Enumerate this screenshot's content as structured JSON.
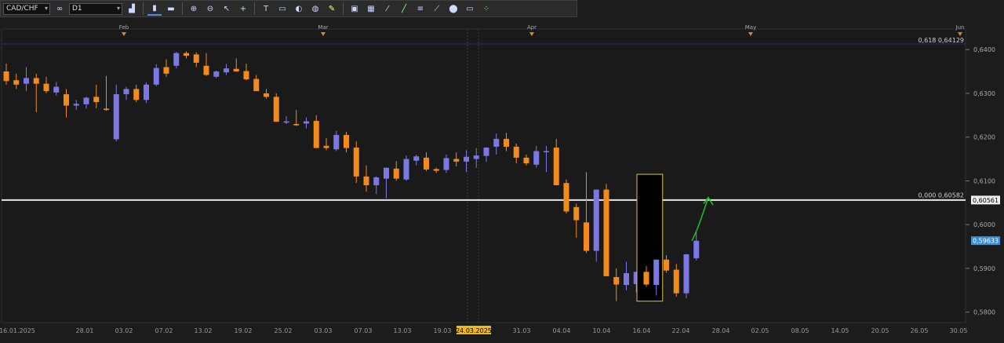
{
  "toolbar": {
    "symbol": "CAD/CHF",
    "timeframe": "D1",
    "icons": [
      "link-icon",
      "chart-type-icon",
      "candles-icon",
      "bars-icon",
      "zoom-in-icon",
      "zoom-out-icon",
      "cursor-icon",
      "crosshair-icon",
      "text-tool-icon",
      "note-icon",
      "eraser-icon",
      "globe-icon",
      "pencil-icon",
      "screenshot-icon",
      "grid-icon",
      "fibonacci-icon",
      "trendline-icon",
      "channel-icon",
      "gann-icon",
      "shapes-icon",
      "hide-icon",
      "indicators-icon"
    ]
  },
  "months": [
    "Feb",
    "Mar",
    "Apr",
    "May",
    "Jun"
  ],
  "date_labels": [
    "16.01.2025",
    "28.01",
    "03.02",
    "07.02",
    "13.02",
    "19.02",
    "25.02",
    "03.03",
    "07.03",
    "13.03",
    "19.03",
    "24.03.2025",
    "31.03",
    "04.04",
    "10.04",
    "16.04",
    "22.04",
    "28.04",
    "02.05",
    "08.05",
    "14.05",
    "20.05",
    "26.05",
    "30.05"
  ],
  "price_labels": [
    "0,6400",
    "0,6300",
    "0,6200",
    "0,6100",
    "0,6000",
    "0,5900",
    "0,5800"
  ],
  "levels": {
    "fib_618": "0,618 0,64129",
    "fib_000": "0,000 0,60582",
    "horizontal_line_price": "0,60561",
    "current_price": "0,59633"
  },
  "colors": {
    "bull": "#7b78e6",
    "bear": "#f28a1c",
    "highlight_box": "#d9c73a",
    "arrow": "#22c022",
    "current_price_bg": "#3a8fd9"
  },
  "chart_data": {
    "type": "candlestick",
    "symbol": "CAD/CHF",
    "timeframe": "D1",
    "ylim": [
      0.5776,
      0.6447
    ],
    "fib_levels": [
      {
        "label": "0,618",
        "price": 0.64129
      },
      {
        "label": "0,000",
        "price": 0.60582
      }
    ],
    "horizontal_line": 0.60561,
    "last_price": 0.59633,
    "candles": [
      [
        0.635,
        0.6368,
        0.632,
        0.6328
      ],
      [
        0.633,
        0.6345,
        0.631,
        0.632
      ],
      [
        0.6322,
        0.636,
        0.6305,
        0.6335
      ],
      [
        0.6335,
        0.6345,
        0.6257,
        0.6322
      ],
      [
        0.6322,
        0.6338,
        0.63,
        0.6305
      ],
      [
        0.6302,
        0.6326,
        0.6295,
        0.6315
      ],
      [
        0.6298,
        0.631,
        0.6245,
        0.6272
      ],
      [
        0.6272,
        0.6285,
        0.6262,
        0.6276
      ],
      [
        0.6275,
        0.6292,
        0.6265,
        0.629
      ],
      [
        0.6292,
        0.632,
        0.6266,
        0.628
      ],
      [
        0.6265,
        0.634,
        0.626,
        0.6262
      ],
      [
        0.6195,
        0.632,
        0.619,
        0.6298
      ],
      [
        0.6298,
        0.6315,
        0.6285,
        0.631
      ],
      [
        0.631,
        0.632,
        0.628,
        0.6285
      ],
      [
        0.6285,
        0.6325,
        0.6278,
        0.632
      ],
      [
        0.632,
        0.6367,
        0.6316,
        0.6358
      ],
      [
        0.636,
        0.6378,
        0.6338,
        0.6345
      ],
      [
        0.6363,
        0.6395,
        0.6357,
        0.6392
      ],
      [
        0.6392,
        0.6396,
        0.638,
        0.6386
      ],
      [
        0.6389,
        0.6394,
        0.636,
        0.637
      ],
      [
        0.6363,
        0.6392,
        0.634,
        0.6342
      ],
      [
        0.6338,
        0.6352,
        0.6335,
        0.635
      ],
      [
        0.6348,
        0.6367,
        0.6342,
        0.6357
      ],
      [
        0.6356,
        0.638,
        0.635,
        0.635
      ],
      [
        0.6351,
        0.6368,
        0.633,
        0.6332
      ],
      [
        0.6333,
        0.6342,
        0.6305,
        0.6305
      ],
      [
        0.63,
        0.631,
        0.6288,
        0.6292
      ],
      [
        0.6292,
        0.63,
        0.6235,
        0.6235
      ],
      [
        0.6233,
        0.6248,
        0.623,
        0.6236
      ],
      [
        0.623,
        0.6262,
        0.6225,
        0.6227
      ],
      [
        0.6231,
        0.6245,
        0.622,
        0.6236
      ],
      [
        0.6237,
        0.625,
        0.6175,
        0.6175
      ],
      [
        0.618,
        0.6198,
        0.617,
        0.6175
      ],
      [
        0.6172,
        0.6214,
        0.6168,
        0.6205
      ],
      [
        0.6205,
        0.6212,
        0.6165,
        0.6175
      ],
      [
        0.6176,
        0.619,
        0.6095,
        0.611
      ],
      [
        0.611,
        0.6135,
        0.6075,
        0.609
      ],
      [
        0.609,
        0.611,
        0.607,
        0.6108
      ],
      [
        0.6105,
        0.613,
        0.606,
        0.613
      ],
      [
        0.6128,
        0.6145,
        0.61,
        0.6105
      ],
      [
        0.6103,
        0.6158,
        0.61,
        0.615
      ],
      [
        0.6146,
        0.616,
        0.6135,
        0.6156
      ],
      [
        0.6153,
        0.6165,
        0.6122,
        0.6126
      ],
      [
        0.6127,
        0.613,
        0.6118,
        0.6123
      ],
      [
        0.6125,
        0.616,
        0.6118,
        0.6152
      ],
      [
        0.615,
        0.6165,
        0.6133,
        0.6144
      ],
      [
        0.6144,
        0.617,
        0.612,
        0.6155
      ],
      [
        0.615,
        0.6175,
        0.613,
        0.6158
      ],
      [
        0.6157,
        0.6177,
        0.6143,
        0.6176
      ],
      [
        0.6178,
        0.6208,
        0.616,
        0.6196
      ],
      [
        0.6196,
        0.621,
        0.6168,
        0.6178
      ],
      [
        0.6178,
        0.6185,
        0.614,
        0.6153
      ],
      [
        0.6153,
        0.616,
        0.6135,
        0.614
      ],
      [
        0.6137,
        0.618,
        0.613,
        0.6168
      ],
      [
        0.6168,
        0.618,
        0.612,
        0.6168
      ],
      [
        0.6176,
        0.6196,
        0.609,
        0.609
      ],
      [
        0.6095,
        0.6103,
        0.6025,
        0.603
      ],
      [
        0.604,
        0.6048,
        0.597,
        0.601
      ],
      [
        0.6005,
        0.612,
        0.5935,
        0.594
      ],
      [
        0.594,
        0.608,
        0.5915,
        0.608
      ],
      [
        0.608,
        0.6093,
        0.5885,
        0.5882
      ],
      [
        0.588,
        0.59,
        0.5825,
        0.5863
      ],
      [
        0.5862,
        0.5915,
        0.585,
        0.5889
      ],
      [
        0.5864,
        0.589,
        0.5845,
        0.5892
      ],
      [
        0.5892,
        0.5905,
        0.5858,
        0.5863
      ],
      [
        0.5862,
        0.592,
        0.5838,
        0.592
      ],
      [
        0.592,
        0.593,
        0.589,
        0.5895
      ],
      [
        0.5897,
        0.591,
        0.5835,
        0.5843
      ],
      [
        0.5843,
        0.5933,
        0.5832,
        0.5932
      ],
      [
        0.5923,
        0.5982,
        0.5918,
        0.5963
      ]
    ]
  }
}
